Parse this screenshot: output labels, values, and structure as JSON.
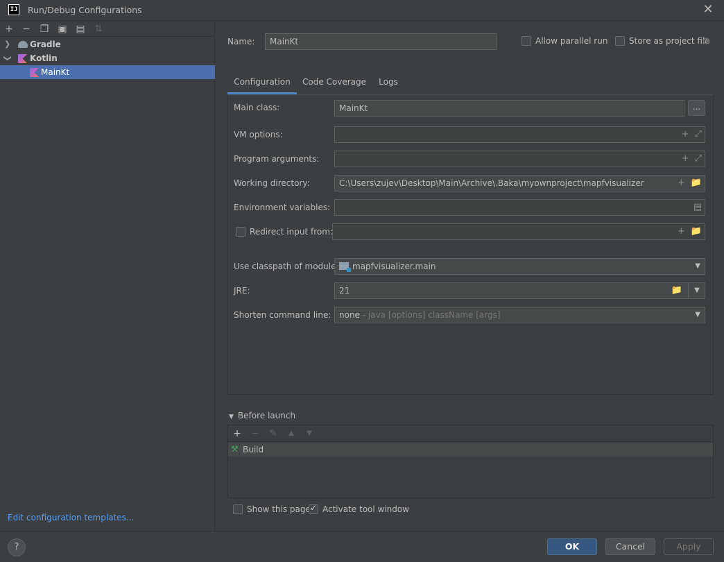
{
  "window": {
    "title": "Run/Debug Configurations",
    "logo_text": "IJ"
  },
  "left": {
    "tree": [
      {
        "label": "Gradle",
        "icon": "gradle-icon",
        "expanded": false
      },
      {
        "label": "Kotlin",
        "icon": "kotlin-icon",
        "expanded": true
      },
      {
        "label": "MainKt",
        "icon": "kotlin-icon",
        "selected": true
      }
    ],
    "edit_templates_link": "Edit configuration templates..."
  },
  "header": {
    "name_label": "Name:",
    "name_value": "MainKt",
    "allow_parallel_label": "Allow parallel run",
    "store_as_project_label": "Store as project file"
  },
  "tabs": [
    {
      "label": "Configuration",
      "active": true
    },
    {
      "label": "Code Coverage",
      "active": false
    },
    {
      "label": "Logs",
      "active": false
    }
  ],
  "form": {
    "main_class_label": "Main class:",
    "main_class_value": "MainKt",
    "browse_label": "...",
    "vm_options_label": "VM options:",
    "vm_options_value": "",
    "program_args_label": "Program arguments:",
    "program_args_value": "",
    "working_dir_label": "Working directory:",
    "working_dir_value": "C:\\Users\\zujev\\Desktop\\Main\\Archive\\.Baka\\myownproject\\mapfvisualizer",
    "env_vars_label": "Environment variables:",
    "env_vars_value": "",
    "redirect_label": "Redirect input from:",
    "redirect_value": "",
    "classpath_label": "Use classpath of module:",
    "classpath_value": "mapfvisualizer.main",
    "jre_label": "JRE:",
    "jre_value": "21",
    "shorten_label": "Shorten command line:",
    "shorten_value": "none",
    "shorten_hint": " - java [options] className [args]"
  },
  "before_launch": {
    "header": "Before launch",
    "tasks": [
      {
        "label": "Build"
      }
    ]
  },
  "options": {
    "show_page_label": "Show this page",
    "show_page_checked": false,
    "activate_tool_label": "Activate tool window",
    "activate_tool_checked": true
  },
  "buttons": {
    "help": "?",
    "ok": "OK",
    "cancel": "Cancel",
    "apply": "Apply"
  },
  "colors": {
    "background": "#3c3f41",
    "selection": "#4b6eaf",
    "link": "#589df6",
    "ok_button": "#365880",
    "active_tab": "#4a88c7"
  }
}
